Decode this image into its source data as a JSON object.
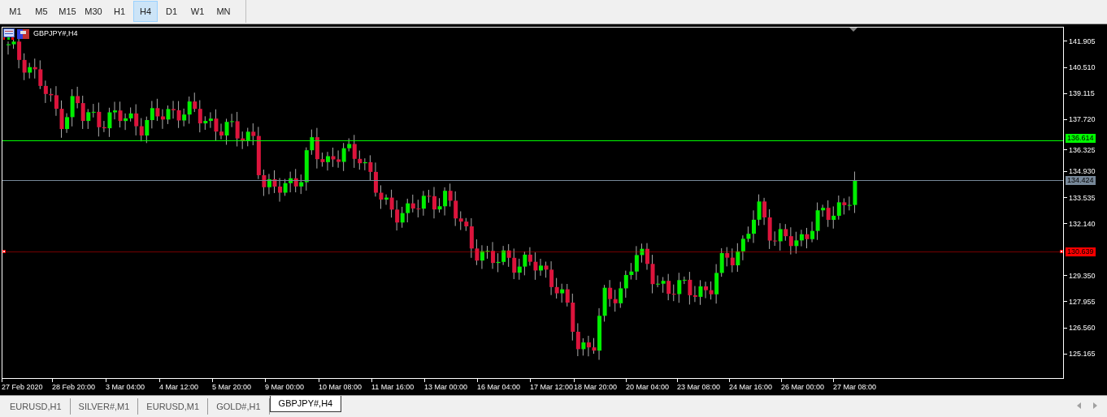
{
  "toolbar": {
    "timeframes": [
      {
        "label": "M1",
        "selected": false
      },
      {
        "label": "M5",
        "selected": false
      },
      {
        "label": "M15",
        "selected": false
      },
      {
        "label": "M30",
        "selected": false
      },
      {
        "label": "H1",
        "selected": false
      },
      {
        "label": "H4",
        "selected": true
      },
      {
        "label": "D1",
        "selected": false
      },
      {
        "label": "W1",
        "selected": false
      },
      {
        "label": "MN",
        "selected": false
      }
    ]
  },
  "chart": {
    "title": "GBPJPY#,H4",
    "price_axis": [
      "141.905",
      "140.510",
      "139.115",
      "137.720",
      "136.325",
      "134.930",
      "133.535",
      "132.140",
      "129.350",
      "127.955",
      "126.560",
      "125.165"
    ],
    "price_lines": [
      {
        "label": "136.614",
        "color": "#00ff00"
      },
      {
        "label": "134.424",
        "color": "#778899"
      },
      {
        "label": "130.639",
        "color": "#ff0000"
      }
    ],
    "time_axis": [
      "27 Feb 2020",
      "28 Feb 20:00",
      "3 Mar 04:00",
      "4 Mar 12:00",
      "5 Mar 20:00",
      "9 Mar 00:00",
      "10 Mar 08:00",
      "11 Mar 16:00",
      "13 Mar 00:00",
      "16 Mar 04:00",
      "17 Mar 12:00",
      "18 Mar 20:00",
      "20 Mar 04:00",
      "23 Mar 08:00",
      "24 Mar 16:00",
      "26 Mar 00:00",
      "27 Mar 08:00"
    ]
  },
  "tabs": [
    {
      "label": "EURUSD,H1",
      "selected": false
    },
    {
      "label": "SILVER#,M1",
      "selected": false
    },
    {
      "label": "EURUSD,M1",
      "selected": false
    },
    {
      "label": "GOLD#,H1",
      "selected": false
    },
    {
      "label": "GBPJPY#,H4",
      "selected": true
    }
  ]
}
